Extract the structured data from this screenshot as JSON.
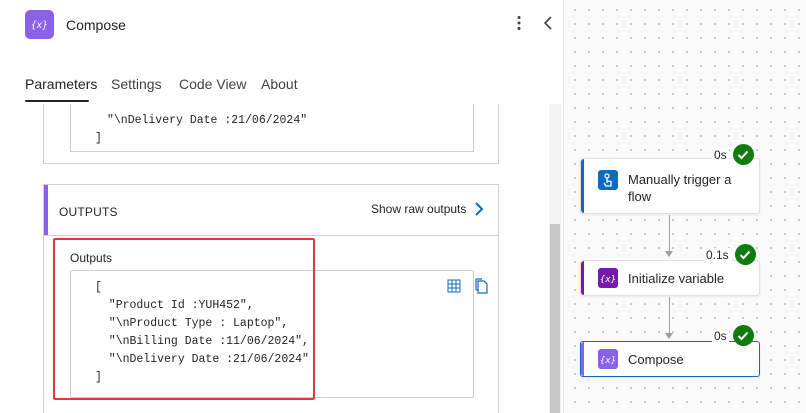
{
  "panel": {
    "title": "Compose",
    "tabs": [
      {
        "label": "Parameters",
        "active": true
      },
      {
        "label": "Settings",
        "active": false
      },
      {
        "label": "Code View",
        "active": false
      },
      {
        "label": "About",
        "active": false
      }
    ],
    "inputs_tail": [
      "\"\\nDelivery Date :21/06/2024\"",
      "]"
    ],
    "outputs": {
      "section_title": "OUTPUTS",
      "raw_button": "Show raw outputs",
      "label": "Outputs",
      "code_lines": [
        "[",
        "  \"Product Id :YUH452\",",
        "  \"\\nProduct Type : Laptop\",",
        "  \"\\nBilling Date :11/06/2024\",",
        "  \"\\nDelivery Date :21/06/2024\"",
        "]"
      ]
    }
  },
  "flow": {
    "nodes": [
      {
        "label_line1": "Manually trigger a",
        "label_line2": "flow",
        "duration": "0s",
        "icon": "hand-touch-icon",
        "accent": "#0f6cbd"
      },
      {
        "label": "Initialize variable",
        "duration": "0.1s",
        "icon": "variable-icon",
        "accent": "#7719aa"
      },
      {
        "label": "Compose",
        "duration": "0s",
        "icon": "compose-icon",
        "accent": "#8b61e8"
      }
    ]
  },
  "colors": {
    "accent_purple": "#8b61e8",
    "success_green": "#107c10",
    "highlight_red": "#e0383e",
    "link_blue": "#0f6cbd"
  }
}
